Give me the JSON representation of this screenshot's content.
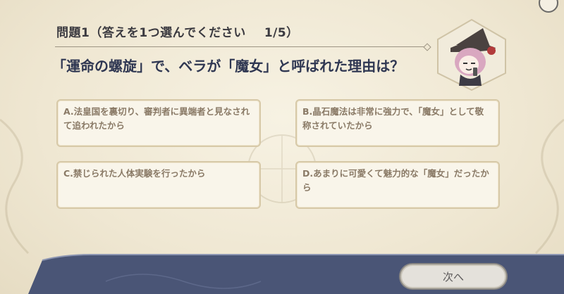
{
  "quiz": {
    "title": "問題1（答えを1つ選んでください",
    "counter": "1/5）",
    "question": "「運命の螺旋」で、ベラが「魔女」と呼ばれた理由は？",
    "options": [
      {
        "id": "A",
        "label": "A.法皇国を裏切り、審判者に異端者と見なされて追われたから"
      },
      {
        "id": "B",
        "label": "B.晶石魔法は非常に強力で、「魔女」として敬称されていたから"
      },
      {
        "id": "C",
        "label": "C.禁じられた人体実験を行ったから"
      },
      {
        "id": "D",
        "label": "D.あまりに可愛くて魅力的な「魔女」だったから"
      }
    ],
    "next_label": "次へ"
  },
  "colors": {
    "background": "#efe7d2",
    "question_text": "#2f3752",
    "option_border": "#d7c9a8",
    "footer": "#4a5576"
  },
  "icons": [
    "close-icon",
    "character-portrait"
  ]
}
